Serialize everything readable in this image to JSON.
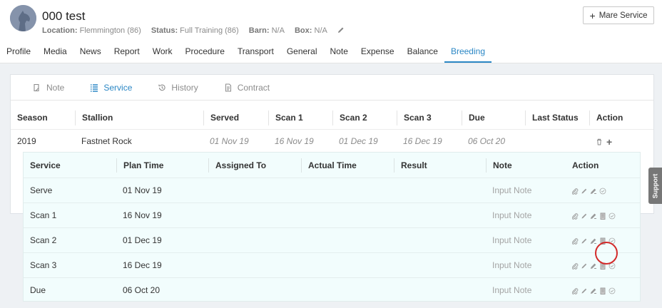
{
  "horse": {
    "name": "000 test",
    "location_label": "Location:",
    "location": "Flemmington (86)",
    "status_label": "Status:",
    "status": "Full Training (86)",
    "barn_label": "Barn:",
    "barn": "N/A",
    "box_label": "Box:",
    "box": "N/A"
  },
  "header": {
    "mare_service_label": "Mare Service"
  },
  "nav": {
    "active": "Breeding",
    "items": [
      "Profile",
      "Media",
      "News",
      "Report",
      "Work",
      "Procedure",
      "Transport",
      "General",
      "Note",
      "Expense",
      "Balance",
      "Breeding"
    ]
  },
  "subtabs": {
    "active": "Service",
    "items": [
      {
        "label": "Note",
        "icon": "note-icon"
      },
      {
        "label": "Service",
        "icon": "list-icon"
      },
      {
        "label": "History",
        "icon": "history-icon"
      },
      {
        "label": "Contract",
        "icon": "contract-icon"
      }
    ]
  },
  "season_table": {
    "headers": [
      "Season",
      "Stallion",
      "Served",
      "Scan 1",
      "Scan 2",
      "Scan 3",
      "Due",
      "Last Status",
      "Action"
    ],
    "row": {
      "season": "2019",
      "stallion": "Fastnet Rock",
      "served": "01 Nov 19",
      "scan1": "16 Nov 19",
      "scan2": "01 Dec 19",
      "scan3": "16 Dec 19",
      "due": "06 Oct 20",
      "last_status": ""
    }
  },
  "service_table": {
    "headers": [
      "Service",
      "Plan Time",
      "Assigned To",
      "Actual Time",
      "Result",
      "Note",
      "Action"
    ],
    "rows": [
      {
        "service": "Serve",
        "plan_time": "01 Nov 19",
        "assigned_to": "",
        "actual_time": "",
        "result": "",
        "note": "Input Note"
      },
      {
        "service": "Scan 1",
        "plan_time": "16 Nov 19",
        "assigned_to": "",
        "actual_time": "",
        "result": "",
        "note": "Input Note"
      },
      {
        "service": "Scan 2",
        "plan_time": "01 Dec 19",
        "assigned_to": "",
        "actual_time": "",
        "result": "",
        "note": "Input Note"
      },
      {
        "service": "Scan 3",
        "plan_time": "16 Dec 19",
        "assigned_to": "",
        "actual_time": "",
        "result": "",
        "note": "Input Note"
      },
      {
        "service": "Due",
        "plan_time": "06 Oct 20",
        "assigned_to": "",
        "actual_time": "",
        "result": "",
        "note": "Input Note"
      }
    ]
  },
  "support": {
    "label": "Support"
  },
  "colors": {
    "accent": "#2b87c5",
    "highlight": "#d32a2a",
    "subpanel_bg": "#f2fdfd"
  }
}
